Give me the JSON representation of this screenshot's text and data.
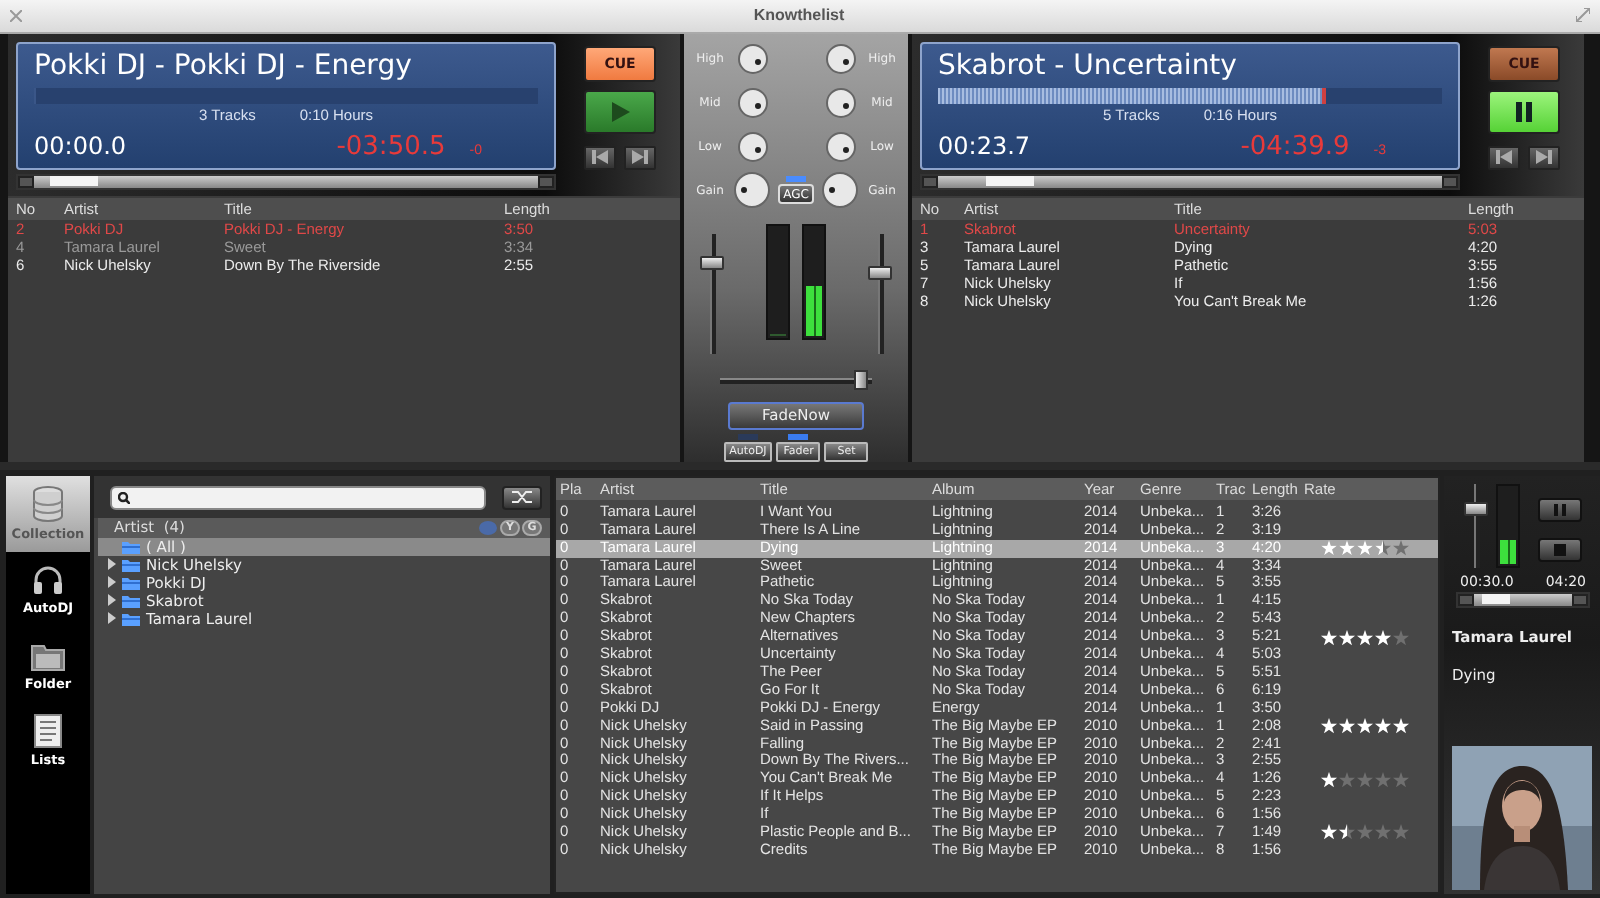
{
  "window": {
    "title": "Knowthelist"
  },
  "decks": [
    {
      "title": "Pokki DJ - Pokki DJ - Energy",
      "level": 0,
      "tracks": "3 Tracks",
      "hours": "0:10 Hours",
      "elapsed": "00:00.0",
      "remaining": "-03:50.5",
      "pitch": "-0",
      "cue_label": "CUE",
      "cue_lit": true,
      "playing": false,
      "playlist": {
        "columns": [
          "No",
          "Artist",
          "Title",
          "Length"
        ],
        "rows": [
          {
            "no": "2",
            "artist": "Pokki DJ",
            "title": "Pokki DJ - Energy",
            "length": "3:50",
            "current": true,
            "played": false
          },
          {
            "no": "4",
            "artist": "Tamara Laurel",
            "title": "Sweet",
            "length": "3:34",
            "current": false,
            "played": true
          },
          {
            "no": "6",
            "artist": "Nick Uhelsky",
            "title": "Down By The Riverside",
            "length": "2:55",
            "current": false,
            "played": false
          }
        ]
      }
    },
    {
      "title": "Skabrot - Uncertainty",
      "level": 0.77,
      "tracks": "5 Tracks",
      "hours": "0:16 Hours",
      "elapsed": "00:23.7",
      "remaining": "-04:39.9",
      "pitch": "-3",
      "cue_label": "CUE",
      "cue_lit": false,
      "playing": true,
      "playlist": {
        "columns": [
          "No",
          "Artist",
          "Title",
          "Length"
        ],
        "rows": [
          {
            "no": "1",
            "artist": "Skabrot",
            "title": "Uncertainty",
            "length": "5:03",
            "current": true,
            "played": false
          },
          {
            "no": "3",
            "artist": "Tamara Laurel",
            "title": "Dying",
            "length": "4:20",
            "current": false,
            "played": false
          },
          {
            "no": "5",
            "artist": "Tamara Laurel",
            "title": "Pathetic",
            "length": "3:55",
            "current": false,
            "played": false
          },
          {
            "no": "7",
            "artist": "Nick Uhelsky",
            "title": "If",
            "length": "1:56",
            "current": false,
            "played": false
          },
          {
            "no": "8",
            "artist": "Nick Uhelsky",
            "title": "You Can't Break Me",
            "length": "1:26",
            "current": false,
            "played": false
          }
        ]
      }
    }
  ],
  "mixer": {
    "eq_left": [
      "High",
      "Mid",
      "Low",
      "Gain"
    ],
    "eq_right": [
      "High",
      "Mid",
      "Low",
      "Gain"
    ],
    "agc": {
      "label": "AGC",
      "on": true
    },
    "volumes": [
      {
        "level": 0.8
      },
      {
        "level": 0.7
      }
    ],
    "meters": [
      {
        "level": 0
      },
      {
        "level": 0.45
      }
    ],
    "crossfader": {
      "level": 0.97
    },
    "fade_now": "FadeNow",
    "buttons": [
      {
        "label": "AutoDJ",
        "kind": "toggle",
        "on": false
      },
      {
        "label": "Fader",
        "kind": "toggle",
        "on": true
      },
      {
        "label": "Set",
        "kind": "push"
      }
    ]
  },
  "sidebar": {
    "items": [
      {
        "label": "Collection",
        "kind": "collection",
        "selected": true
      },
      {
        "label": "AutoDJ",
        "kind": "autodj",
        "selected": false
      },
      {
        "label": "Folder",
        "kind": "folder",
        "selected": false
      },
      {
        "label": "Lists",
        "kind": "lists",
        "selected": false
      }
    ]
  },
  "tree": {
    "header": "Artist  (4)",
    "filters": [
      {
        "label": "Y",
        "selected": false
      },
      {
        "label": "G",
        "selected": false
      }
    ],
    "items": [
      {
        "label": "( All )",
        "selected": true
      },
      {
        "label": "Nick Uhelsky",
        "selected": false,
        "expanded": false
      },
      {
        "label": "Pokki DJ",
        "selected": false,
        "expanded": false
      },
      {
        "label": "Skabrot",
        "selected": false,
        "expanded": false
      },
      {
        "label": "Tamara Laurel",
        "selected": false,
        "expanded": false
      }
    ]
  },
  "table": {
    "columns": [
      "Pla",
      "Artist",
      "Title",
      "Album",
      "Year",
      "Genre",
      "Trac",
      "Length",
      "Rate"
    ],
    "rows": [
      {
        "cells": [
          "0",
          "Tamara Laurel",
          "I Want You",
          "Lightning",
          "2014",
          "Unbeka...",
          "1",
          "3:26"
        ],
        "selected": false
      },
      {
        "cells": [
          "0",
          "Tamara Laurel",
          "There Is A Line",
          "Lightning",
          "2014",
          "Unbeka...",
          "2",
          "3:19"
        ],
        "selected": false
      },
      {
        "cells": [
          "0",
          "Tamara Laurel",
          "Dying",
          "Lightning",
          "2014",
          "Unbeka...",
          "3",
          "4:20"
        ],
        "selected": true,
        "stars": 3.5
      },
      {
        "cells": [
          "0",
          "Tamara Laurel",
          "Sweet",
          "Lightning",
          "2014",
          "Unbeka...",
          "4",
          "3:34"
        ],
        "selected": false
      },
      {
        "cells": [
          "0",
          "Tamara Laurel",
          "Pathetic",
          "Lightning",
          "2014",
          "Unbeka...",
          "5",
          "3:55"
        ],
        "selected": false
      },
      {
        "cells": [
          "0",
          "Skabrot",
          "No Ska Today",
          "No Ska Today",
          "2014",
          "Unbeka...",
          "1",
          "4:15"
        ],
        "selected": false
      },
      {
        "cells": [
          "0",
          "Skabrot",
          "New Chapters",
          "No Ska Today",
          "2014",
          "Unbeka...",
          "2",
          "5:43"
        ],
        "selected": false
      },
      {
        "cells": [
          "0",
          "Skabrot",
          "Alternatives",
          "No Ska Today",
          "2014",
          "Unbeka...",
          "3",
          "5:21"
        ],
        "selected": false,
        "stars": 4
      },
      {
        "cells": [
          "0",
          "Skabrot",
          "Uncertainty",
          "No Ska Today",
          "2014",
          "Unbeka...",
          "4",
          "5:03"
        ],
        "selected": false
      },
      {
        "cells": [
          "0",
          "Skabrot",
          "The Peer",
          "No Ska Today",
          "2014",
          "Unbeka...",
          "5",
          "5:51"
        ],
        "selected": false
      },
      {
        "cells": [
          "0",
          "Skabrot",
          "Go For It",
          "No Ska Today",
          "2014",
          "Unbeka...",
          "6",
          "6:19"
        ],
        "selected": false
      },
      {
        "cells": [
          "0",
          "Pokki DJ",
          "Pokki DJ - Energy",
          "Energy",
          "2014",
          "Unbeka...",
          "1",
          "3:50"
        ],
        "selected": false
      },
      {
        "cells": [
          "0",
          "Nick Uhelsky",
          "Said in Passing",
          "The Big Maybe EP",
          "2010",
          "Unbeka...",
          "1",
          "2:08"
        ],
        "selected": false,
        "stars": 5
      },
      {
        "cells": [
          "0",
          "Nick Uhelsky",
          "Falling",
          "The Big Maybe EP",
          "2010",
          "Unbeka...",
          "2",
          "2:41"
        ],
        "selected": false
      },
      {
        "cells": [
          "0",
          "Nick Uhelsky",
          "Down By The Rivers...",
          "The Big Maybe EP",
          "2010",
          "Unbeka...",
          "3",
          "2:55"
        ],
        "selected": false
      },
      {
        "cells": [
          "0",
          "Nick Uhelsky",
          "You Can't Break Me",
          "The Big Maybe EP",
          "2010",
          "Unbeka...",
          "4",
          "1:26"
        ],
        "selected": false,
        "stars": 1
      },
      {
        "cells": [
          "0",
          "Nick Uhelsky",
          "If It Helps",
          "The Big Maybe EP",
          "2010",
          "Unbeka...",
          "5",
          "2:23"
        ],
        "selected": false
      },
      {
        "cells": [
          "0",
          "Nick Uhelsky",
          "If",
          "The Big Maybe EP",
          "2010",
          "Unbeka...",
          "6",
          "1:56"
        ],
        "selected": false
      },
      {
        "cells": [
          "0",
          "Nick Uhelsky",
          "Plastic People and B...",
          "The Big Maybe EP",
          "2010",
          "Unbeka...",
          "7",
          "1:49"
        ],
        "selected": false,
        "stars": 1.5
      },
      {
        "cells": [
          "0",
          "Nick Uhelsky",
          "Credits",
          "The Big Maybe EP",
          "2010",
          "Unbeka...",
          "8",
          "1:56"
        ],
        "selected": false
      }
    ]
  },
  "mini_player": {
    "volume": {
      "level": 0.75
    },
    "meter": {
      "level": 0.3
    },
    "elapsed": "00:30.0",
    "total": "04:20",
    "artist": "Tamara Laurel",
    "title": "Dying"
  }
}
